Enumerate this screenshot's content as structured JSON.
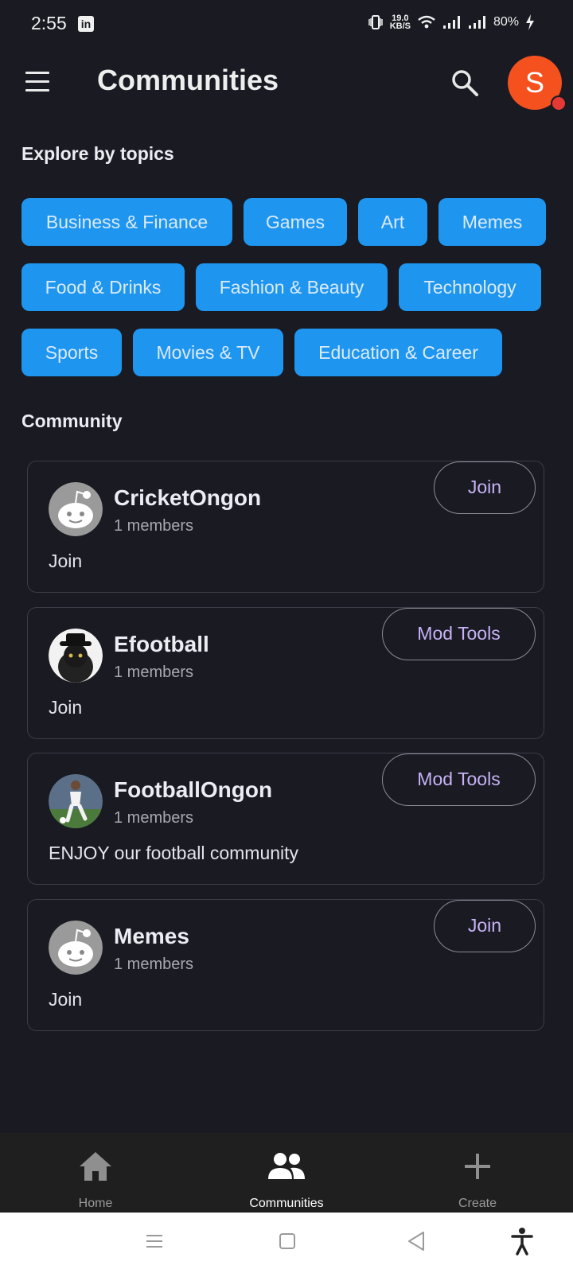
{
  "status": {
    "time": "2:55",
    "net_speed_value": "19.0",
    "net_speed_unit": "KB/S",
    "battery": "80%"
  },
  "header": {
    "title": "Communities"
  },
  "avatar_letter": "S",
  "topics": {
    "title": "Explore by topics",
    "items": [
      "Business & Finance",
      "Games",
      "Art",
      "Memes",
      "Food & Drinks",
      "Fashion & Beauty",
      "Technology",
      "Sports",
      "Movies & TV",
      "Education & Career"
    ]
  },
  "community": {
    "title": "Community",
    "items": [
      {
        "name": "CricketOngon",
        "members": "1 members",
        "description": "Join",
        "button": "Join",
        "avatar": "default-avatar-icon"
      },
      {
        "name": "Efootball",
        "members": "1 members",
        "description": "Join",
        "button": "Mod Tools",
        "avatar": "cat-avatar-icon"
      },
      {
        "name": "FootballOngon",
        "members": "1 members",
        "description": "ENJOY our football community",
        "button": "Mod Tools",
        "avatar": "football-player-avatar-icon"
      },
      {
        "name": "Memes",
        "members": "1 members",
        "description": "Join",
        "button": "Join",
        "avatar": "default-avatar-icon"
      }
    ]
  },
  "bottom_nav": {
    "items": [
      {
        "label": "Home",
        "icon": "home-icon",
        "active": false
      },
      {
        "label": "Communities",
        "icon": "communities-icon",
        "active": true
      },
      {
        "label": "Create",
        "icon": "plus-icon",
        "active": false
      }
    ]
  },
  "colors": {
    "background": "#191a22",
    "chip": "#1e96f0",
    "accent_button_text": "#c7b2f5",
    "avatar": "#f4511e"
  }
}
